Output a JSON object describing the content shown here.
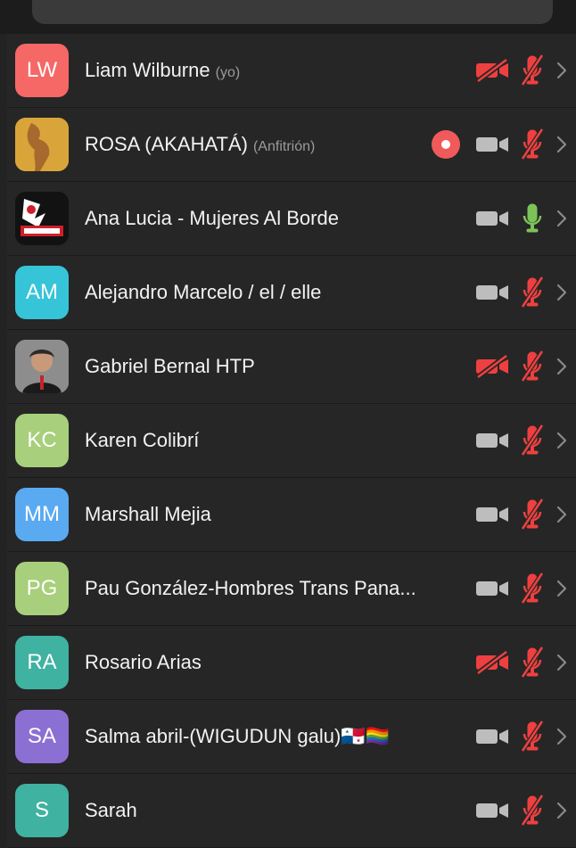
{
  "participants": [
    {
      "name": "Liam Wilburne",
      "tag": "(yo)",
      "initials": "LW",
      "avatar_color": "#f56866",
      "recording": false,
      "video_off": true,
      "muted": true
    },
    {
      "name": "ROSA (AKAHATÁ)",
      "tag": "(Anfitrión)",
      "initials": "",
      "avatar_color": "#d9a53a",
      "recording": true,
      "video_off": false,
      "muted": true
    },
    {
      "name": "Ana Lucia - Mujeres Al Borde",
      "tag": "",
      "initials": "",
      "avatar_color": "#121212",
      "recording": false,
      "video_off": false,
      "muted": false
    },
    {
      "name": "Alejandro Marcelo / el / elle",
      "tag": "",
      "initials": "AM",
      "avatar_color": "#36c4d8",
      "recording": false,
      "video_off": false,
      "muted": true
    },
    {
      "name": "Gabriel Bernal HTP",
      "tag": "",
      "initials": "",
      "avatar_color": "#9a9a9a",
      "recording": false,
      "video_off": true,
      "muted": true
    },
    {
      "name": "Karen Colibrí",
      "tag": "",
      "initials": "KC",
      "avatar_color": "#a8cf7b",
      "recording": false,
      "video_off": false,
      "muted": true
    },
    {
      "name": "Marshall Mejia",
      "tag": "",
      "initials": "MM",
      "avatar_color": "#5aaaf2",
      "recording": false,
      "video_off": false,
      "muted": true
    },
    {
      "name": "Pau González-Hombres Trans Pana...",
      "tag": "",
      "initials": "PG",
      "avatar_color": "#a8cf7b",
      "recording": false,
      "video_off": false,
      "muted": true
    },
    {
      "name": "Rosario Arias",
      "tag": "",
      "initials": "RA",
      "avatar_color": "#3fb2a1",
      "recording": false,
      "video_off": true,
      "muted": true
    },
    {
      "name": "Salma abril-(WIGUDUN galu)🇵🇦🏳️‍🌈",
      "tag": "",
      "initials": "SA",
      "avatar_color": "#8c6fd3",
      "recording": false,
      "video_off": false,
      "muted": true
    },
    {
      "name": "Sarah",
      "tag": "",
      "initials": "S",
      "avatar_color": "#3fb2a1",
      "recording": false,
      "video_off": false,
      "muted": true
    }
  ],
  "colors": {
    "danger": "#ee4040",
    "camera_on": "#bdbdbd",
    "mic_on": "#7cc35a",
    "chevron": "#8a8a8a"
  }
}
